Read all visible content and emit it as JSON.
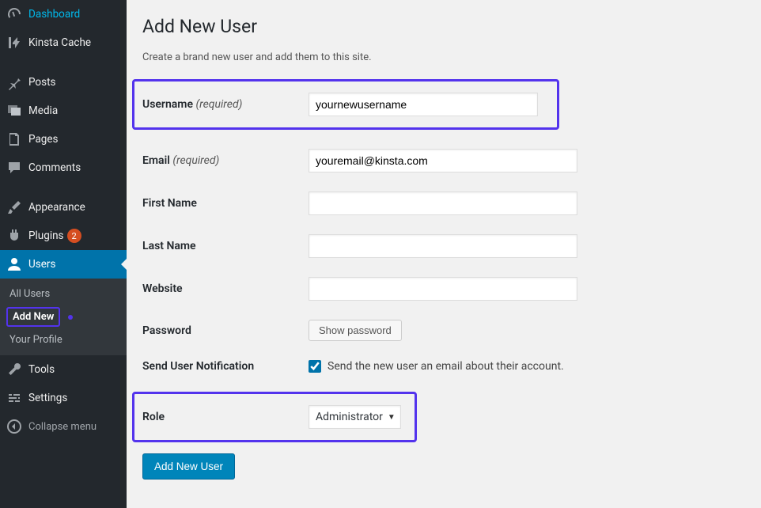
{
  "sidebar": {
    "dashboard": "Dashboard",
    "kinsta_cache": "Kinsta Cache",
    "posts": "Posts",
    "media": "Media",
    "pages": "Pages",
    "comments": "Comments",
    "appearance": "Appearance",
    "plugins": "Plugins",
    "plugins_badge": "2",
    "users": "Users",
    "submenu": {
      "all_users": "All Users",
      "add_new": "Add New",
      "your_profile": "Your Profile"
    },
    "tools": "Tools",
    "settings": "Settings",
    "collapse": "Collapse menu"
  },
  "page": {
    "title": "Add New User",
    "description": "Create a brand new user and add them to this site.",
    "labels": {
      "username": "Username",
      "required": "(required)",
      "email": "Email",
      "first_name": "First Name",
      "last_name": "Last Name",
      "website": "Website",
      "password": "Password",
      "send_notification": "Send User Notification",
      "role": "Role"
    },
    "values": {
      "username": "yournewusername",
      "email": "youremail@kinsta.com",
      "first_name": "",
      "last_name": "",
      "website": "",
      "role_selected": "Administrator"
    },
    "buttons": {
      "show_password": "Show password",
      "submit": "Add New User"
    },
    "notification_text": "Send the new user an email about their account."
  }
}
